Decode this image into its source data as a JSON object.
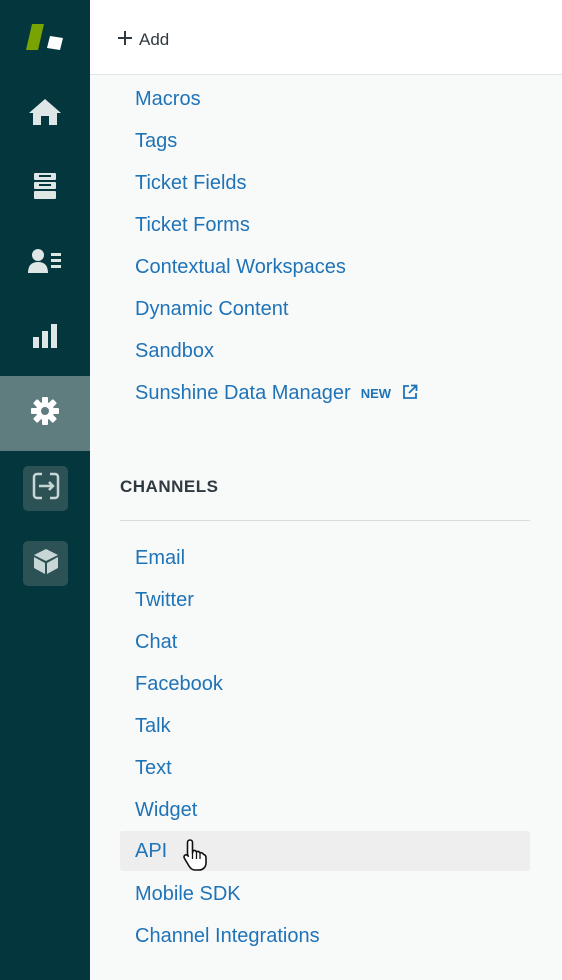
{
  "topbar": {
    "add_label": "Add"
  },
  "nav": {
    "items": [
      {
        "icon": "home-icon"
      },
      {
        "icon": "views-icon"
      },
      {
        "icon": "customers-icon"
      },
      {
        "icon": "reporting-icon"
      },
      {
        "icon": "admin-gear-icon",
        "active": true
      },
      {
        "icon": "connect-app-icon"
      },
      {
        "icon": "sunshine-app-icon"
      }
    ]
  },
  "manage": {
    "items": [
      {
        "label": "Macros"
      },
      {
        "label": "Tags"
      },
      {
        "label": "Ticket Fields"
      },
      {
        "label": "Ticket Forms"
      },
      {
        "label": "Contextual Workspaces"
      },
      {
        "label": "Dynamic Content"
      },
      {
        "label": "Sandbox"
      },
      {
        "label": "Sunshine Data Manager",
        "badge": "NEW"
      }
    ]
  },
  "channels": {
    "title": "CHANNELS",
    "items": [
      {
        "label": "Email"
      },
      {
        "label": "Twitter"
      },
      {
        "label": "Chat"
      },
      {
        "label": "Facebook"
      },
      {
        "label": "Talk"
      },
      {
        "label": "Text"
      },
      {
        "label": "Widget"
      },
      {
        "label": "API",
        "hovered": true
      },
      {
        "label": "Mobile SDK"
      },
      {
        "label": "Channel Integrations"
      }
    ]
  },
  "colors": {
    "rail": "#03363d",
    "rail_active": "#5f7c7e",
    "link": "#1f73b7",
    "brand_green": "#78a300"
  }
}
